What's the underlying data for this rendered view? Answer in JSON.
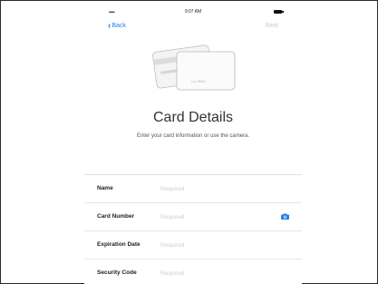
{
  "status_bar": {
    "signal": "•••••",
    "time": "9:07 AM"
  },
  "nav": {
    "back_label": "Back",
    "next_label": "Next"
  },
  "illustration": {
    "card_text": "•••• 9024"
  },
  "header": {
    "title": "Card Details",
    "subtitle": "Enter your card information or use the camera."
  },
  "form": {
    "rows": [
      {
        "label": "Name",
        "placeholder": "Required"
      },
      {
        "label": "Card Number",
        "placeholder": "Required"
      },
      {
        "label": "Expiration Date",
        "placeholder": "Required"
      },
      {
        "label": "Security Code",
        "placeholder": "Required"
      }
    ]
  },
  "colors": {
    "accent": "#2b7de9",
    "disabled": "#c9c9c9",
    "placeholder": "#cfcfcf"
  },
  "icons": {
    "back": "chevron-left-icon",
    "camera": "camera-icon",
    "battery": "battery-icon"
  }
}
